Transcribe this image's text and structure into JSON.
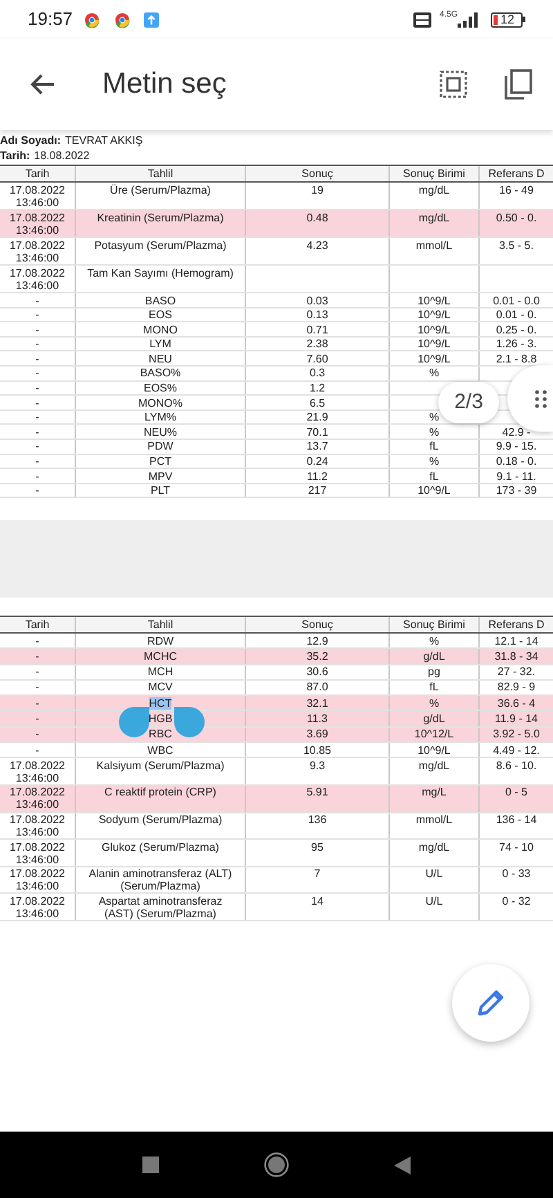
{
  "status_bar": {
    "time": "19:57",
    "network": "4.5G",
    "battery": "12"
  },
  "app_bar": {
    "title": "Metin seç"
  },
  "document": {
    "patient_label": "Adı Soyadı:",
    "patient_name": "TEVRAT AKKIŞ",
    "date_label": "Tarih:",
    "date": "18.08.2022",
    "pages": [
      {
        "columns": [
          "Tarih",
          "Tahlil",
          "Sonuç",
          "Sonuç Birimi",
          "Referans D"
        ],
        "rows": [
          {
            "date": "17.08.2022 13:46:00",
            "test": "Üre (Serum/Plazma)",
            "result": "19",
            "unit": "mg/dL",
            "reference": "16 - 49",
            "flagged": false,
            "selected": false
          },
          {
            "date": "17.08.2022 13:46:00",
            "test": "Kreatinin (Serum/Plazma)",
            "result": "0.48",
            "unit": "mg/dL",
            "reference": "0.50 - 0.",
            "flagged": true,
            "selected": false
          },
          {
            "date": "17.08.2022 13:46:00",
            "test": "Potasyum (Serum/Plazma)",
            "result": "4.23",
            "unit": "mmol/L",
            "reference": "3.5 - 5.",
            "flagged": false,
            "selected": false
          },
          {
            "date": "17.08.2022 13:46:00",
            "test": "Tam Kan Sayımı (Hemogram)",
            "flagged": false,
            "selected": false
          },
          {
            "date": "-",
            "test": "BASO",
            "result": "0.03",
            "unit": "10^9/L",
            "reference": "0.01 - 0.0",
            "flagged": false,
            "selected": false
          },
          {
            "date": "-",
            "test": "EOS",
            "result": "0.13",
            "unit": "10^9/L",
            "reference": "0.01 - 0.",
            "flagged": false,
            "selected": false
          },
          {
            "date": "-",
            "test": "MONO",
            "result": "0.71",
            "unit": "10^9/L",
            "reference": "0.25 - 0.",
            "flagged": false,
            "selected": false
          },
          {
            "date": "-",
            "test": "LYM",
            "result": "2.38",
            "unit": "10^9/L",
            "reference": "1.26 - 3.",
            "flagged": false,
            "selected": false
          },
          {
            "date": "-",
            "test": "NEU",
            "result": "7.60",
            "unit": "10^9/L",
            "reference": "2.1 - 8.8",
            "flagged": false,
            "selected": false
          },
          {
            "date": "-",
            "test": "BASO%",
            "result": "0.3",
            "unit": "%",
            "flagged": false,
            "selected": false
          },
          {
            "date": "-",
            "test": "EOS%",
            "result": "1.2",
            "flagged": false,
            "selected": false
          },
          {
            "date": "-",
            "test": "MONO%",
            "result": "6.5",
            "flagged": false,
            "selected": false
          },
          {
            "date": "-",
            "test": "LYM%",
            "result": "21.9",
            "unit": "%",
            "flagged": false,
            "selected": false
          },
          {
            "date": "-",
            "test": "NEU%",
            "result": "70.1",
            "unit": "%",
            "reference": "42.9 -",
            "flagged": false,
            "selected": false
          },
          {
            "date": "-",
            "test": "PDW",
            "result": "13.7",
            "unit": "fL",
            "reference": "9.9 - 15.",
            "flagged": false,
            "selected": false
          },
          {
            "date": "-",
            "test": "PCT",
            "result": "0.24",
            "unit": "%",
            "reference": "0.18 - 0.",
            "flagged": false,
            "selected": false
          },
          {
            "date": "-",
            "test": "MPV",
            "result": "11.2",
            "unit": "fL",
            "reference": "9.1 - 11.",
            "flagged": false,
            "selected": false
          },
          {
            "date": "-",
            "test": "PLT",
            "result": "217",
            "unit": "10^9/L",
            "reference": "173 - 39",
            "flagged": false,
            "selected": false
          }
        ]
      },
      {
        "columns": [
          "Tarih",
          "Tahlil",
          "Sonuç",
          "Sonuç Birimi",
          "Referans D"
        ],
        "rows": [
          {
            "date": "-",
            "test": "RDW",
            "result": "12.9",
            "unit": "%",
            "reference": "12.1 - 14",
            "flagged": false,
            "selected": false
          },
          {
            "date": "-",
            "test": "MCHC",
            "result": "35.2",
            "unit": "g/dL",
            "reference": "31.8 - 34",
            "flagged": true,
            "selected": false
          },
          {
            "date": "-",
            "test": "MCH",
            "result": "30.6",
            "unit": "pg",
            "reference": "27 - 32.",
            "flagged": false,
            "selected": false
          },
          {
            "date": "-",
            "test": "MCV",
            "result": "87.0",
            "unit": "fL",
            "reference": "82.9 - 9",
            "flagged": false,
            "selected": false
          },
          {
            "date": "-",
            "test": "HCT",
            "result": "32.1",
            "unit": "%",
            "reference": "36.6 - 4",
            "flagged": true,
            "selected": true
          },
          {
            "date": "-",
            "test": "HGB",
            "result": "11.3",
            "unit": "g/dL",
            "reference": "11.9 - 14",
            "flagged": true,
            "selected": false
          },
          {
            "date": "-",
            "test": "RBC",
            "result": "3.69",
            "unit": "10^12/L",
            "reference": "3.92 - 5.0",
            "flagged": true,
            "selected": false
          },
          {
            "date": "-",
            "test": "WBC",
            "result": "10.85",
            "unit": "10^9/L",
            "reference": "4.49 - 12.",
            "flagged": false,
            "selected": false
          },
          {
            "date": "17.08.2022 13:46:00",
            "test": "Kalsiyum (Serum/Plazma)",
            "result": "9.3",
            "unit": "mg/dL",
            "reference": "8.6 - 10.",
            "flagged": false,
            "selected": false
          },
          {
            "date": "17.08.2022 13:46:00",
            "test": "C reaktif protein (CRP)",
            "result": "5.91",
            "unit": "mg/L",
            "reference": "0 - 5",
            "flagged": true,
            "selected": false
          },
          {
            "date": "17.08.2022 13:46:00",
            "test": "Sodyum (Serum/Plazma)",
            "result": "136",
            "unit": "mmol/L",
            "reference": "136 - 14",
            "flagged": false,
            "selected": false
          },
          {
            "date": "17.08.2022 13:46:00",
            "test": "Glukoz (Serum/Plazma)",
            "result": "95",
            "unit": "mg/dL",
            "reference": "74 - 10",
            "flagged": false,
            "selected": false
          },
          {
            "date": "17.08.2022 13:46:00",
            "test": "Alanin aminotransferaz (ALT)\n(Serum/Plazma)",
            "result": "7",
            "unit": "U/L",
            "reference": "0 - 33",
            "flagged": false,
            "selected": false
          },
          {
            "date": "17.08.2022 13:46:00",
            "test": "Aspartat aminotransferaz\n(AST) (Serum/Plazma)",
            "result": "14",
            "unit": "U/L",
            "reference": "0 - 32",
            "flagged": false,
            "selected": false
          }
        ]
      }
    ]
  },
  "page_indicator": "2/3"
}
